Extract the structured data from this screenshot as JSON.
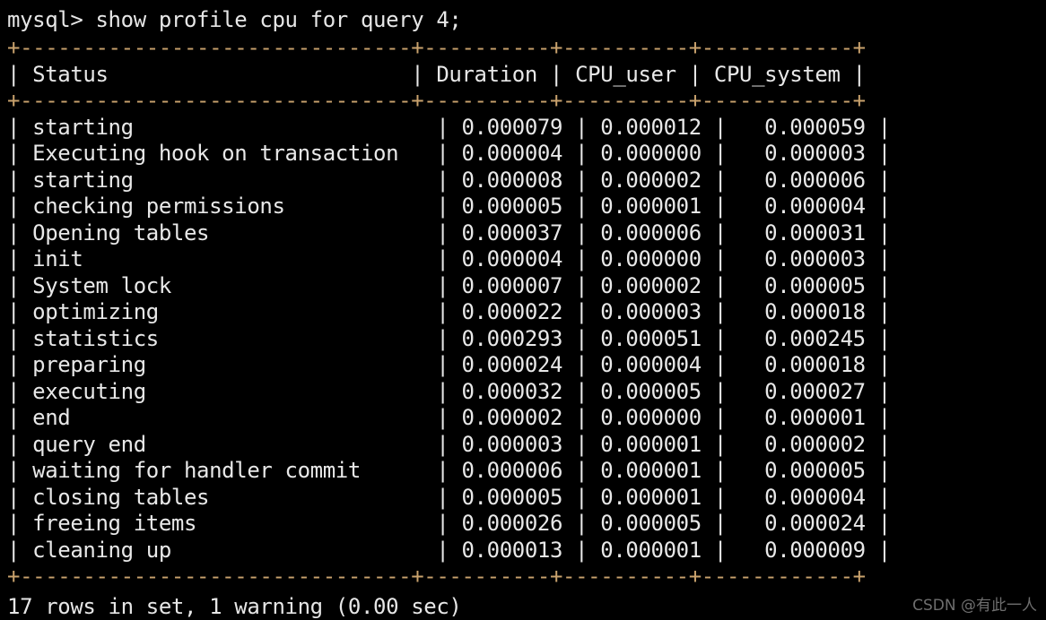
{
  "terminal": {
    "background_color": "#000000",
    "text_color": "#d8d8d8",
    "border_color": "#c9a26d",
    "prompt": "mysql> show profile cpu for query 4;",
    "footer": "17 rows in set, 1 warning (0.00 sec)",
    "watermark": "CSDN @有此一人"
  },
  "table": {
    "columns": [
      {
        "name": "Status",
        "width": 31,
        "align": "left"
      },
      {
        "name": "Duration",
        "width": 8,
        "align": "left"
      },
      {
        "name": "CPU_user",
        "width": 8,
        "align": "left"
      },
      {
        "name": "CPU_system",
        "width": 10,
        "align": "right"
      }
    ],
    "rule": "+-------------------------------+----------+----------+------------+",
    "header": "| Status                        | Duration | CPU_user | CPU_system |",
    "rows": [
      {
        "status": "starting",
        "duration": "0.000079",
        "cpu_user": "0.000012",
        "cpu_system": "0.000059"
      },
      {
        "status": "Executing hook on transaction",
        "duration": "0.000004",
        "cpu_user": "0.000000",
        "cpu_system": "0.000003"
      },
      {
        "status": "starting",
        "duration": "0.000008",
        "cpu_user": "0.000002",
        "cpu_system": "0.000006"
      },
      {
        "status": "checking permissions",
        "duration": "0.000005",
        "cpu_user": "0.000001",
        "cpu_system": "0.000004"
      },
      {
        "status": "Opening tables",
        "duration": "0.000037",
        "cpu_user": "0.000006",
        "cpu_system": "0.000031"
      },
      {
        "status": "init",
        "duration": "0.000004",
        "cpu_user": "0.000000",
        "cpu_system": "0.000003"
      },
      {
        "status": "System lock",
        "duration": "0.000007",
        "cpu_user": "0.000002",
        "cpu_system": "0.000005"
      },
      {
        "status": "optimizing",
        "duration": "0.000022",
        "cpu_user": "0.000003",
        "cpu_system": "0.000018"
      },
      {
        "status": "statistics",
        "duration": "0.000293",
        "cpu_user": "0.000051",
        "cpu_system": "0.000245"
      },
      {
        "status": "preparing",
        "duration": "0.000024",
        "cpu_user": "0.000004",
        "cpu_system": "0.000018"
      },
      {
        "status": "executing",
        "duration": "0.000032",
        "cpu_user": "0.000005",
        "cpu_system": "0.000027"
      },
      {
        "status": "end",
        "duration": "0.000002",
        "cpu_user": "0.000000",
        "cpu_system": "0.000001"
      },
      {
        "status": "query end",
        "duration": "0.000003",
        "cpu_user": "0.000001",
        "cpu_system": "0.000002"
      },
      {
        "status": "waiting for handler commit",
        "duration": "0.000006",
        "cpu_user": "0.000001",
        "cpu_system": "0.000005"
      },
      {
        "status": "closing tables",
        "duration": "0.000005",
        "cpu_user": "0.000001",
        "cpu_system": "0.000004"
      },
      {
        "status": "freeing items",
        "duration": "0.000026",
        "cpu_user": "0.000005",
        "cpu_system": "0.000024"
      },
      {
        "status": "cleaning up",
        "duration": "0.000013",
        "cpu_user": "0.000001",
        "cpu_system": "0.000009"
      }
    ]
  }
}
